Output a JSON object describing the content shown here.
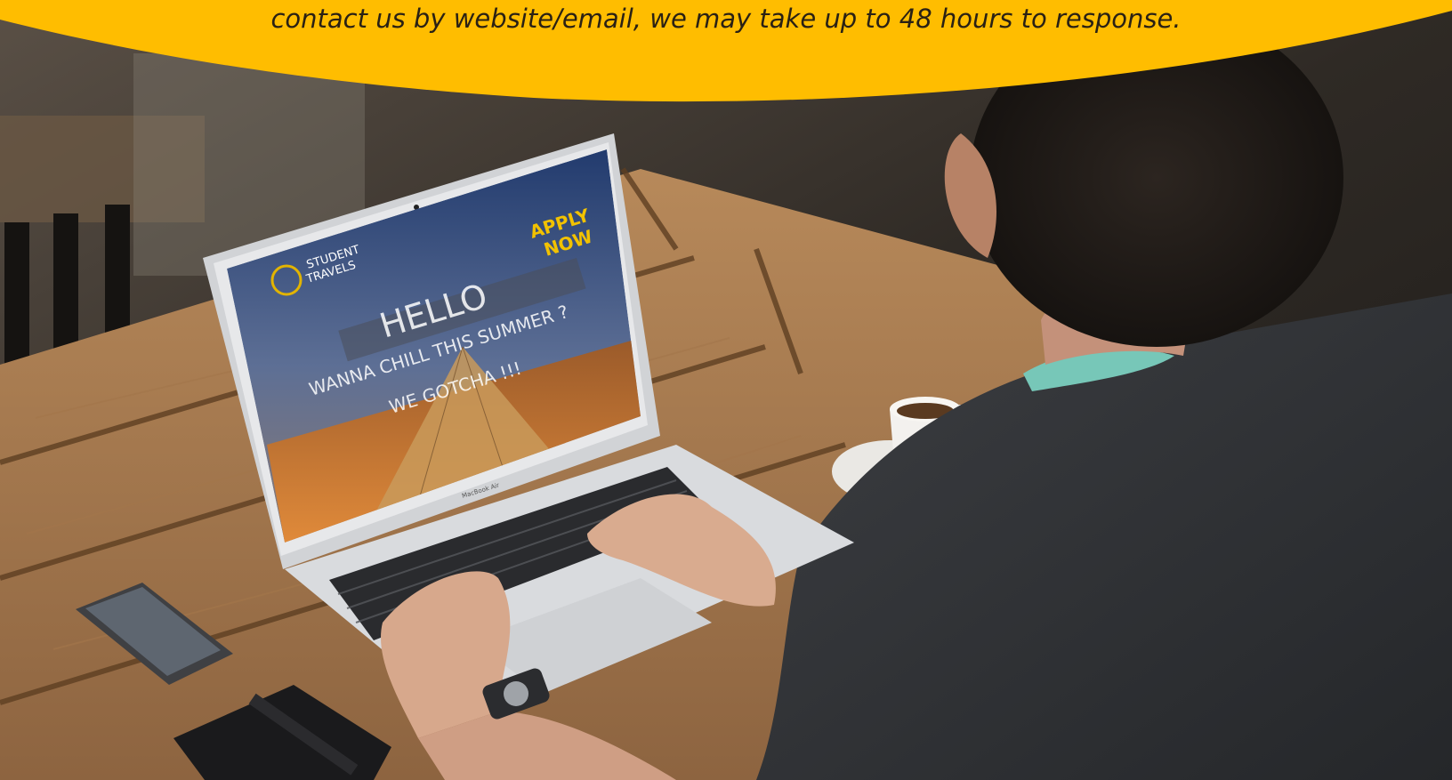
{
  "banner": {
    "text": "contact us by website/email, we may take up to 48 hours to response.",
    "color": "#FFBD00"
  },
  "screen": {
    "logo_line1": "STUDENT",
    "logo_line2": "TRAVELS",
    "cta_line1": "APPLY",
    "cta_line2": "NOW",
    "hero_line1": "HELLO",
    "hero_line2": "WANNA CHILL THIS SUMMER ?",
    "hero_line3": "WE GOTCHA !!!"
  },
  "laptop": {
    "brand": "MacBook Air"
  }
}
